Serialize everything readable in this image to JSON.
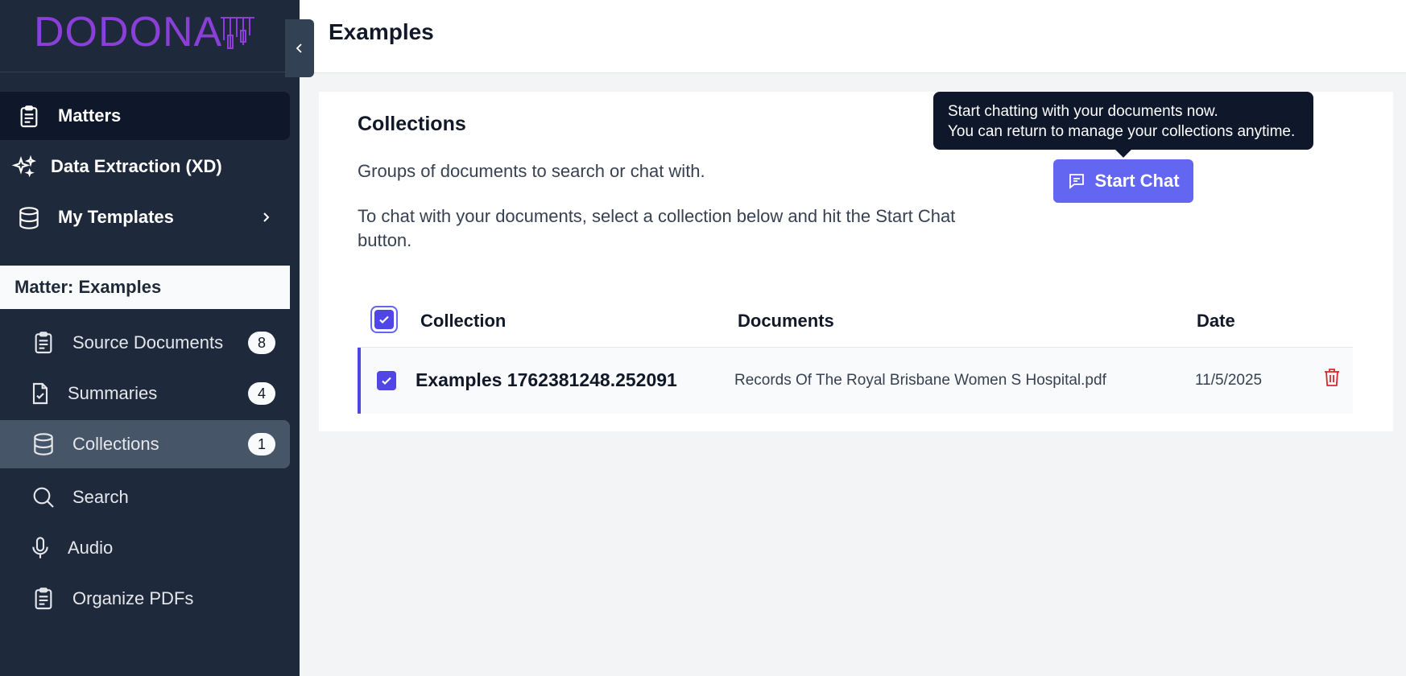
{
  "brand": {
    "logo_text": "DODONA",
    "logo_color": "#8b3fd9"
  },
  "sidebar": {
    "nav": [
      {
        "label": "Matters",
        "icon": "clipboard-icon",
        "active": true
      },
      {
        "label": "Data Extraction (XD)",
        "icon": "sparkles-icon",
        "active": false
      },
      {
        "label": "My Templates",
        "icon": "database-icon",
        "active": false
      }
    ],
    "matter_header": "Matter: Examples",
    "sub_items": [
      {
        "label": "Source Documents",
        "icon": "clipboard-icon",
        "badge": "8"
      },
      {
        "label": "Summaries",
        "icon": "document-check-icon",
        "badge": "4"
      },
      {
        "label": "Collections",
        "icon": "database-icon",
        "badge": "1",
        "active": true
      },
      {
        "label": "Search",
        "icon": "search-icon"
      },
      {
        "label": "Audio",
        "icon": "microphone-icon"
      },
      {
        "label": "Organize PDFs",
        "icon": "clipboard-icon"
      }
    ]
  },
  "header": {
    "title": "Examples"
  },
  "collections": {
    "title": "Collections",
    "description": "Groups of documents to search or chat with.",
    "instructions": "To chat with your documents, select a collection below and hit the Start Chat button.",
    "start_chat_label": "Start Chat",
    "tooltip_line1": "Start chatting with your documents now.",
    "tooltip_line2": "You can return to manage your collections anytime.",
    "columns": {
      "collection": "Collection",
      "documents": "Documents",
      "date": "Date"
    },
    "rows": [
      {
        "name": "Examples 1762381248.252091",
        "documents": "Records Of The Royal Brisbane Women S Hospital.pdf",
        "date": "11/5/2025",
        "selected": true
      }
    ]
  },
  "colors": {
    "accent": "#6366f1",
    "sidebar_bg": "#1e293b",
    "delete": "#dc2626"
  }
}
